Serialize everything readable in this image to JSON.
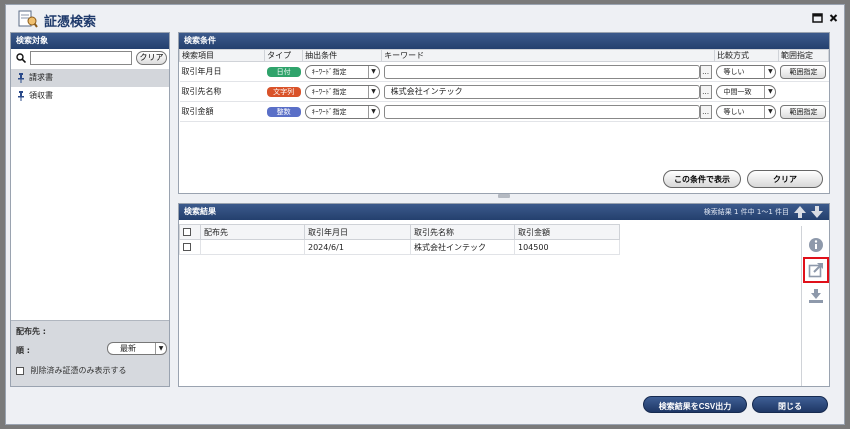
{
  "window": {
    "title": "証憑検索"
  },
  "left": {
    "header": "検索対象",
    "search_placeholder": "",
    "clear_label": "クリア",
    "items": [
      {
        "label": "請求書",
        "selected": true
      },
      {
        "label": "領収書",
        "selected": false
      }
    ],
    "distributor_label": "配布先 :",
    "order_label": "順 :",
    "order_value": "最新",
    "deleted_only_label": "削除済み証憑のみ表示する"
  },
  "conditions": {
    "header": "検索条件",
    "columns": [
      "検索項目",
      "タイプ",
      "抽出条件",
      "キーワード",
      "比較方式",
      "範囲指定"
    ],
    "rows": [
      {
        "item": "取引年月日",
        "type": "日付",
        "type_color": "#2fa36b",
        "extract": "ｷｰﾜｰﾄﾞ指定",
        "keyword": "",
        "compare": "等しい",
        "range": "範囲指定"
      },
      {
        "item": "取引先名称",
        "type": "文字列",
        "type_color": "#d9532a",
        "extract": "ｷｰﾜｰﾄﾞ指定",
        "keyword": "株式会社インテック",
        "compare": "中間一致",
        "range": ""
      },
      {
        "item": "取引金額",
        "type": "整数",
        "type_color": "#5a6fc7",
        "extract": "ｷｰﾜｰﾄﾞ指定",
        "keyword": "",
        "compare": "等しい",
        "range": "範囲指定"
      }
    ],
    "show_button": "この条件で表示",
    "clear_button": "クリア"
  },
  "results": {
    "header": "検索結果",
    "count_text": "検索結果 1 件中 1～1 件目",
    "columns": [
      "配布先",
      "取引年月日",
      "取引先名称",
      "取引金額"
    ],
    "rows": [
      {
        "distributor": "",
        "date": "2024/6/1",
        "partner": "株式会社インテック",
        "amount": "104500"
      }
    ]
  },
  "footer": {
    "csv_button": "検索結果をCSV出力",
    "close_button": "閉じる"
  },
  "colors": {
    "accent": "#24406e",
    "highlight": "#e0101a"
  }
}
